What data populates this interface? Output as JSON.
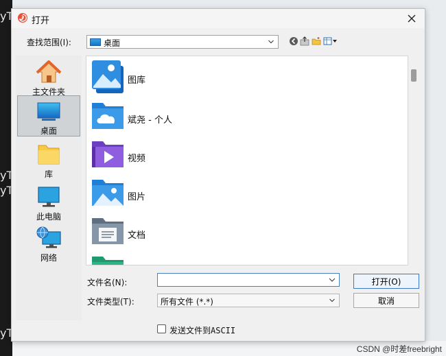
{
  "background": {
    "fragments": [
      "yT",
      "yT",
      "yT",
      "yT"
    ]
  },
  "watermark": "CSDN @时差freebright",
  "dialog": {
    "title": "打开",
    "look_in": {
      "label": "查找范围(I):",
      "value": "桌面"
    },
    "places": [
      {
        "label": "主文件夹",
        "icon": "home-icon"
      },
      {
        "label": "桌面",
        "icon": "desktop-icon",
        "selected": true
      },
      {
        "label": "库",
        "icon": "folder-icon"
      },
      {
        "label": "此电脑",
        "icon": "computer-icon"
      },
      {
        "label": "网络",
        "icon": "network-icon"
      }
    ],
    "files": [
      {
        "name": "图库",
        "icon": "gallery-icon"
      },
      {
        "name": "斌尧 - 个人",
        "icon": "onedrive-folder-icon"
      },
      {
        "name": "视频",
        "icon": "video-folder-icon"
      },
      {
        "name": "图片",
        "icon": "pictures-folder-icon"
      },
      {
        "name": "文档",
        "icon": "documents-folder-icon"
      },
      {
        "name": "",
        "icon": "folder-icon"
      }
    ],
    "file_name": {
      "label": "文件名(N):",
      "value": ""
    },
    "file_type": {
      "label": "文件类型(T):",
      "value": "所有文件 (*.*)"
    },
    "open_button": "打开(O)",
    "cancel_button": "取消",
    "send_ascii": {
      "label": "发送文件到ASCII",
      "checked": false
    }
  }
}
